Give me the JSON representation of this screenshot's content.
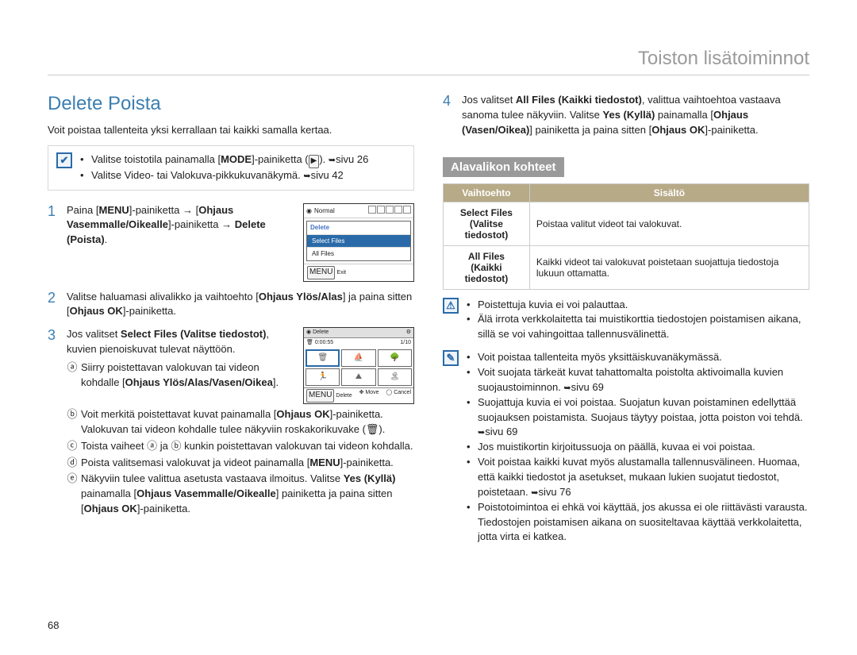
{
  "chapter_title": "Toiston lisätoiminnot",
  "section_title": "Delete Poista",
  "intro": "Voit poistaa tallenteita yksi kerrallaan tai kaikki samalla kertaa.",
  "prereq": {
    "items": [
      {
        "pre": "Valitse toistotila painamalla [",
        "bold1": "MODE",
        "mid": "]-painiketta (",
        "key": "▶",
        "post": "). ",
        "ref": "sivu 26"
      },
      {
        "text": "Valitse Video- tai Valokuva-pikkukuvanäkymä. ",
        "ref": "sivu 42"
      }
    ]
  },
  "steps": {
    "one": {
      "pre": "Paina [",
      "b1": "MENU",
      "mid1": "]-painiketta → [",
      "b2": "Ohjaus Vasemmalle/Oikealle",
      "mid2": "]-painiketta → ",
      "b3": "Delete (Poista)",
      "post": "."
    },
    "two": {
      "pre": "Valitse haluamasi alivalikko ja vaihtoehto [",
      "b1": "Ohjaus Ylös/Alas",
      "mid": "] ja paina sitten [",
      "b2": "Ohjaus OK",
      "post": "]-painiketta."
    },
    "three": {
      "pre": "Jos valitset ",
      "b1": "Select Files (Valitse tiedostot)",
      "post": ", kuvien pienoiskuvat tulevat näyttöön.",
      "a": {
        "pre": "Siirry poistettavan valokuvan tai videon kohdalle [",
        "b": "Ohjaus Ylös/Alas/Vasen/Oikea",
        "post": "]."
      },
      "b": {
        "pre": "Voit merkitä poistettavat kuvat painamalla [",
        "b1": "Ohjaus OK",
        "mid": "]-painiketta. Valokuvan tai videon kohdalle tulee näkyviin roskakorikuvake (",
        "trash": "🗑",
        "post": ")."
      },
      "c": {
        "pre": "Toista vaiheet ",
        "a": "ⓐ",
        "mid": " ja ",
        "bl": "ⓑ",
        "post": " kunkin poistettavan valokuvan tai videon kohdalla."
      },
      "d": {
        "pre": "Poista valitsemasi valokuvat ja videot painamalla [",
        "b1": "MENU",
        "post": "]-painiketta."
      },
      "e": {
        "pre": "Näkyviin tulee valittua asetusta vastaava ilmoitus. Valitse ",
        "b1": "Yes (Kyllä)",
        "mid": " painamalla [",
        "b2": "Ohjaus Vasemmalle/Oikealle",
        "mid2": "] painiketta ja paina sitten [",
        "b3": "Ohjaus OK",
        "post": "]-painiketta."
      }
    },
    "four": {
      "pre": "Jos valitset ",
      "b1": "All Files (Kaikki tiedostot)",
      "mid1": ", valittua vaihtoehtoa vastaava sanoma tulee näkyviin. Valitse ",
      "b2": "Yes (Kyllä)",
      "mid2": " painamalla [",
      "b3": "Ohjaus (Vasen/Oikea)",
      "mid3": "] painiketta ja paina sitten [",
      "b4": "Ohjaus OK",
      "post": "]-painiketta."
    }
  },
  "screen1": {
    "normal": "Normal",
    "menu_title": "Delete",
    "item_select": "Select Files",
    "item_all": "All Files",
    "footer_menu": "MENU",
    "footer_exit": "Exit"
  },
  "screen2": {
    "title": "Delete",
    "timer": "0:00:55",
    "counter": "1/10",
    "footer_menu": "MENU",
    "footer_delete": "Delete",
    "footer_move": "Move",
    "footer_cancel": "Cancel"
  },
  "subsection_title": "Alavalikon kohteet",
  "options_table": {
    "header_option": "Vaihtoehto",
    "header_content": "Sisältö",
    "rows": [
      {
        "label": "Select Files",
        "sub": "(Valitse tiedostot)",
        "desc": "Poistaa valitut videot tai valokuvat."
      },
      {
        "label": "All Files",
        "sub": "(Kaikki tiedostot)",
        "desc": "Kaikki videot tai valokuvat poistetaan suojattuja tiedostoja lukuun ottamatta."
      }
    ]
  },
  "warning": {
    "items": [
      "Poistettuja kuvia ei voi palauttaa.",
      "Älä irrota verkkolaitetta tai muistikorttia tiedostojen poistamisen aikana, sillä se voi vahingoittaa tallennusvälinettä."
    ]
  },
  "notes": {
    "items": [
      {
        "text": "Voit poistaa tallenteita myös yksittäiskuvanäkymässä."
      },
      {
        "text": "Voit suojata tärkeät kuvat tahattomalta poistolta aktivoimalla kuvien suojaustoiminnon. ",
        "ref": "sivu 69"
      },
      {
        "text": "Suojattuja kuvia ei voi poistaa. Suojatun kuvan poistaminen edellyttää suojauksen poistamista. Suojaus täytyy poistaa, jotta poiston voi tehdä. ",
        "ref": "sivu 69"
      },
      {
        "text": "Jos muistikortin kirjoitussuoja on päällä, kuvaa ei voi poistaa."
      },
      {
        "text": "Voit poistaa kaikki kuvat myös alustamalla tallennusvälineen. Huomaa, että kaikki tiedostot ja asetukset, mukaan lukien suojatut tiedostot, poistetaan. ",
        "ref": "sivu 76"
      },
      {
        "text": "Poistotoimintoa ei ehkä voi käyttää, jos akussa ei ole riittävästi varausta. Tiedostojen poistamisen aikana on suositeltavaa käyttää verkkolaitetta, jotta virta ei katkea."
      }
    ]
  },
  "page_number": "68"
}
